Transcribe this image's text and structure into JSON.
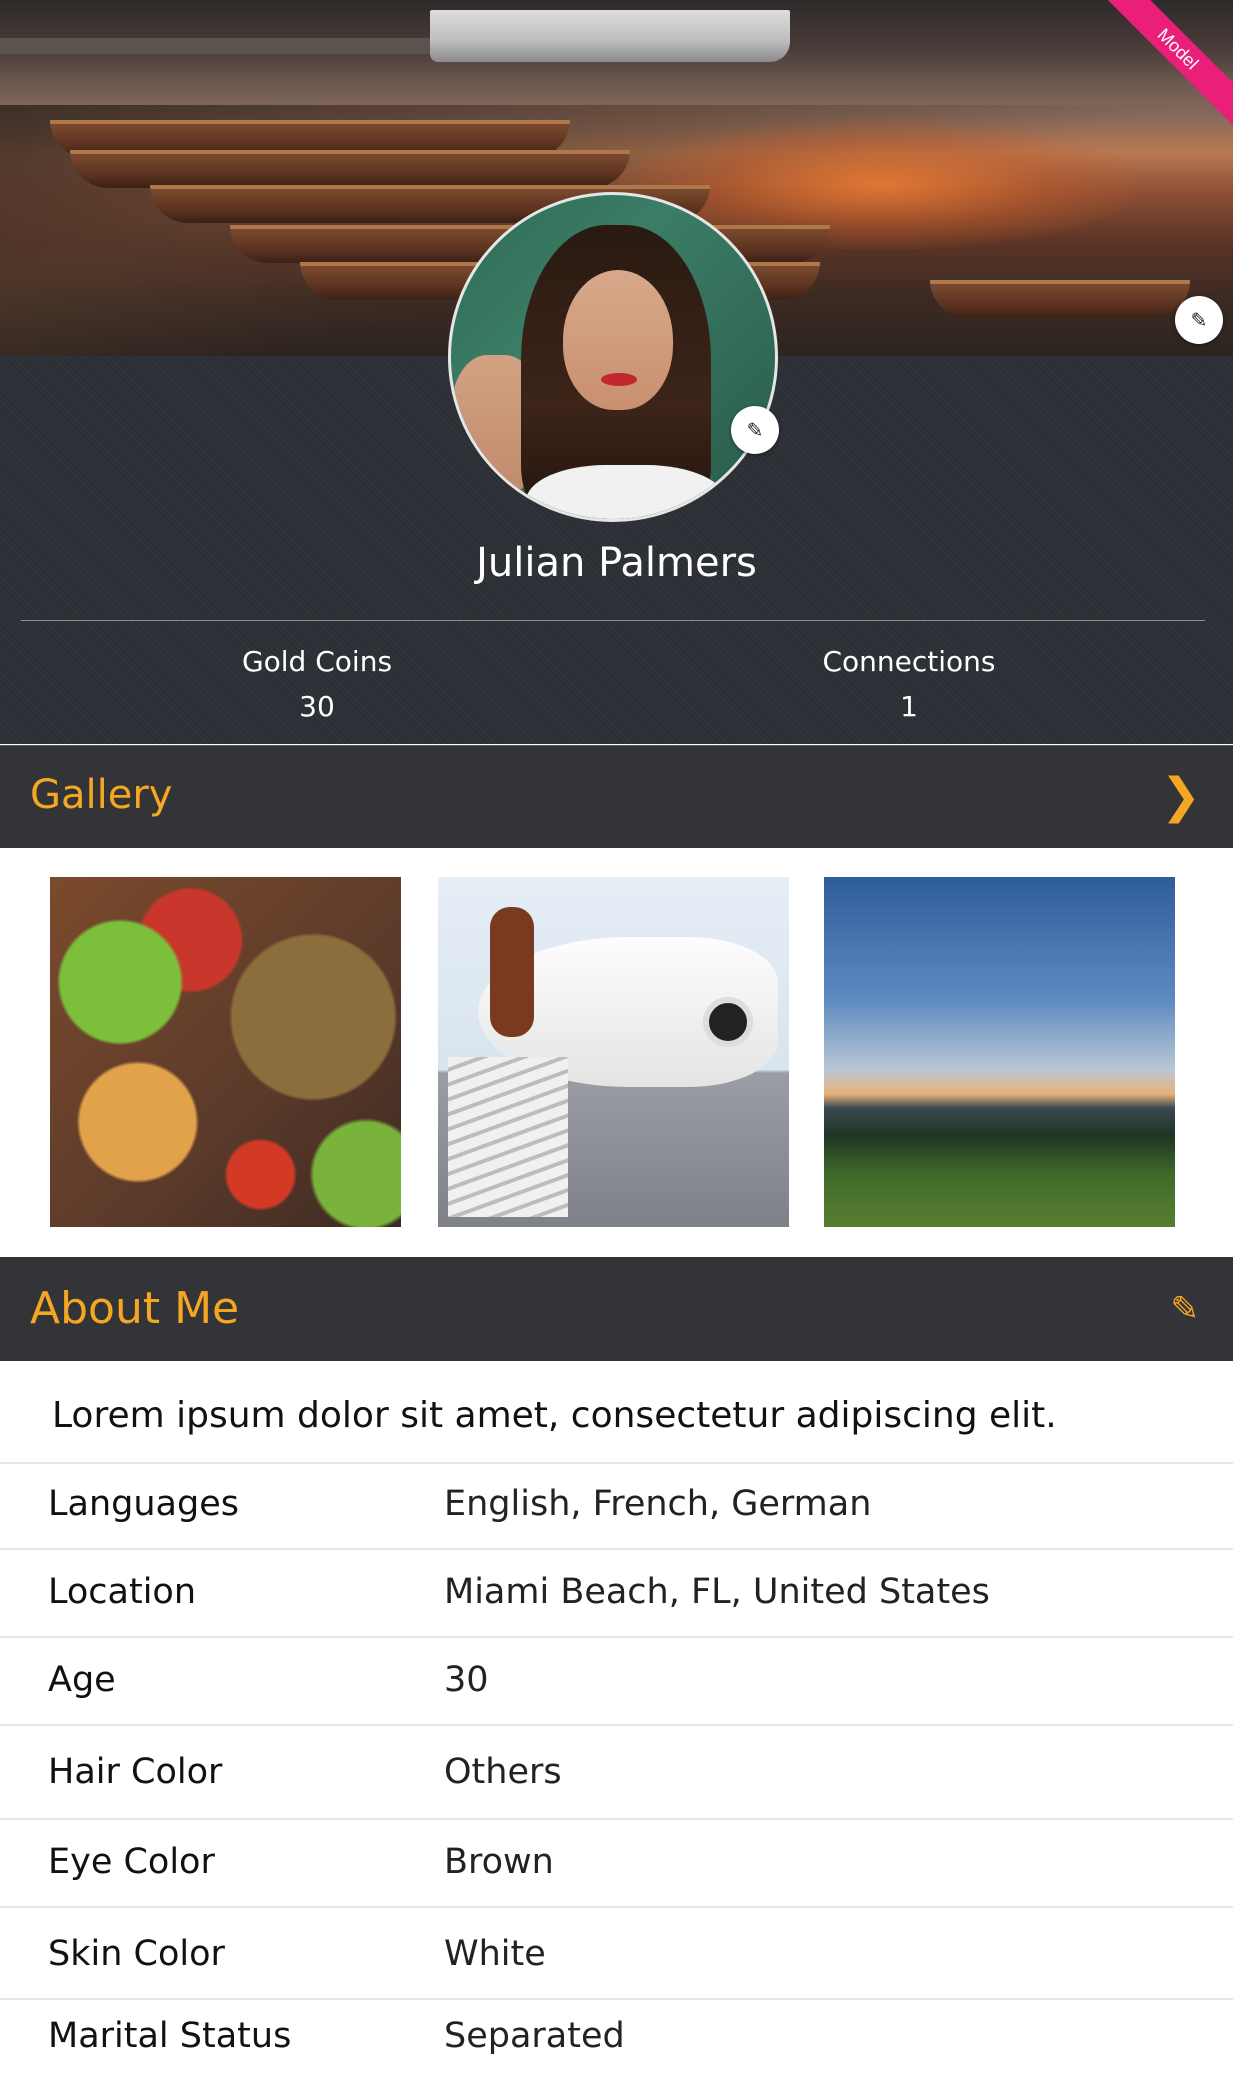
{
  "badge": {
    "label": "Model"
  },
  "profile": {
    "name": "Julian Palmers",
    "stats": [
      {
        "label": "Gold Coins",
        "value": "30"
      },
      {
        "label": "Connections",
        "value": "1"
      }
    ]
  },
  "icons": {
    "cover_edit": "pencil-icon",
    "avatar_edit": "pencil-icon",
    "gallery_next": "chevron-right-icon",
    "about_edit": "pencil-icon"
  },
  "gallery": {
    "title": "Gallery",
    "chevron": "❯"
  },
  "about": {
    "title": "About Me",
    "pencil": "✎",
    "lead": "Lorem ipsum dolor sit amet, consectetur adipiscing elit.",
    "rows": [
      {
        "key": "Languages",
        "value": "English, French, German"
      },
      {
        "key": "Location",
        "value": "Miami Beach, FL, United States"
      },
      {
        "key": "Age",
        "value": "30"
      },
      {
        "key": "Hair Color",
        "value": "Others"
      },
      {
        "key": "Eye Color",
        "value": "Brown"
      },
      {
        "key": "Skin Color",
        "value": "White"
      },
      {
        "key": "Marital Status",
        "value": "Separated"
      }
    ]
  },
  "colors": {
    "accent": "#f5a623",
    "section_bar": "#333437",
    "badge": "#ea1f7a"
  }
}
